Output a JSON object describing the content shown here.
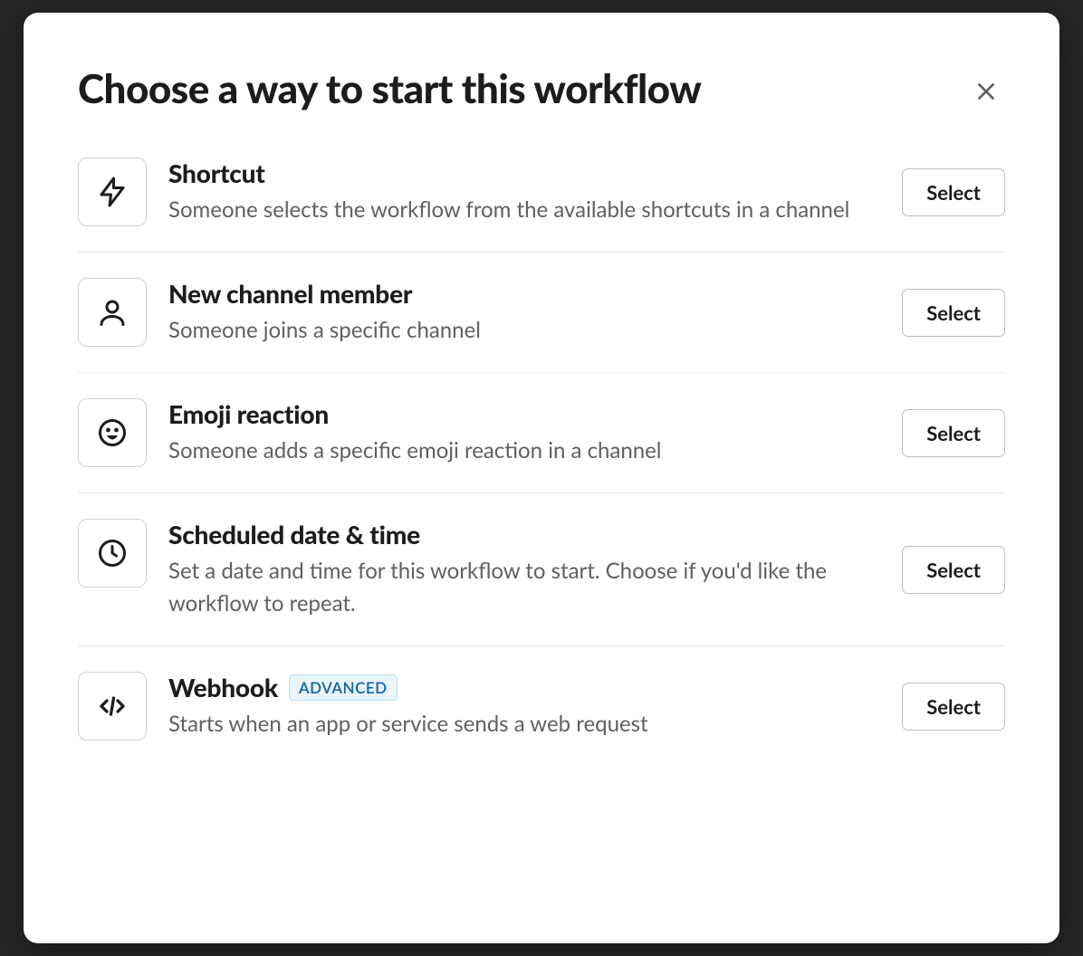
{
  "modal": {
    "title": "Choose a way to start this workflow",
    "select_label": "Select",
    "options": [
      {
        "id": "shortcut",
        "icon": "lightning-bolt-icon",
        "title": "Shortcut",
        "description": "Someone selects the workflow from the available shortcuts in a channel",
        "badge": null
      },
      {
        "id": "new-channel-member",
        "icon": "person-icon",
        "title": "New channel member",
        "description": "Someone joins a specific channel",
        "badge": null
      },
      {
        "id": "emoji-reaction",
        "icon": "smile-icon",
        "title": "Emoji reaction",
        "description": "Someone adds a specific emoji reaction in a channel",
        "badge": null
      },
      {
        "id": "scheduled",
        "icon": "clock-icon",
        "title": "Scheduled date & time",
        "description": "Set a date and time for this workflow to start. Choose if you'd like the workflow to repeat.",
        "badge": null
      },
      {
        "id": "webhook",
        "icon": "code-icon",
        "title": "Webhook",
        "description": "Starts when an app or service sends a web request",
        "badge": "ADVANCED"
      }
    ]
  }
}
